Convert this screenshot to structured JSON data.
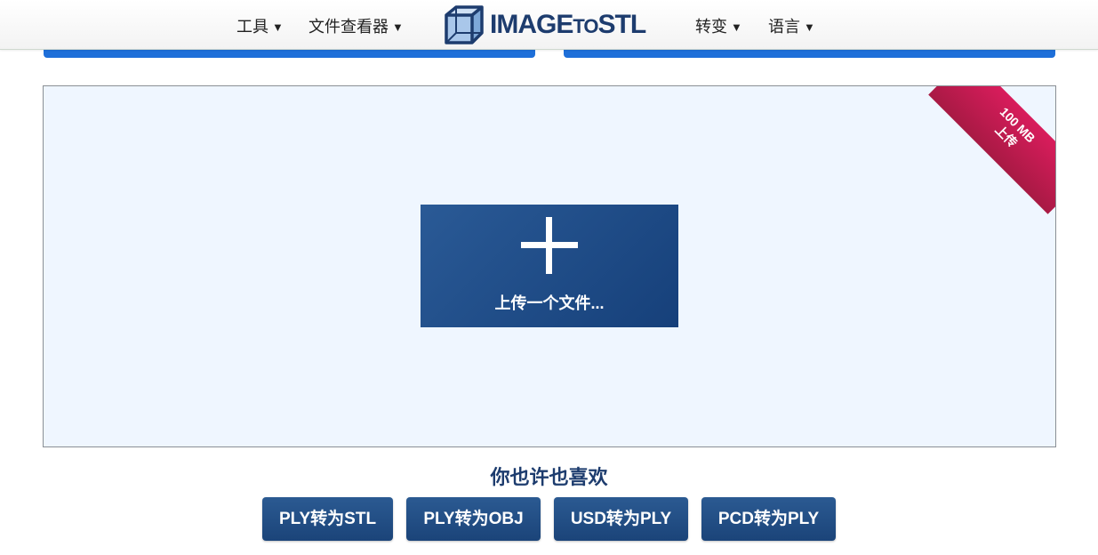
{
  "nav": {
    "tools_label": "工具",
    "viewers_label": "文件查看器",
    "convert_label": "转变",
    "language_label": "语言",
    "logo": {
      "main": "IMAGE",
      "to": "TO",
      "end": "STL"
    }
  },
  "upload": {
    "ribbon_size": "100 MB",
    "ribbon_label": "上传",
    "button_label": "上传一个文件..."
  },
  "suggestions": {
    "title": "你也许也喜欢",
    "items": [
      {
        "label": "PLY转为STL"
      },
      {
        "label": "PLY转为OBJ"
      },
      {
        "label": "USD转为PLY"
      },
      {
        "label": "PCD转为PLY"
      }
    ]
  },
  "colors": {
    "accent_blue": "#1e6fd9",
    "navy": "#1d3c6e",
    "ribbon": "#c21a50",
    "upload_bg": "#eff6ff"
  },
  "icons": {
    "logo": "cube-logo-icon",
    "plus": "plus-icon",
    "caret": "caret-down-icon"
  }
}
